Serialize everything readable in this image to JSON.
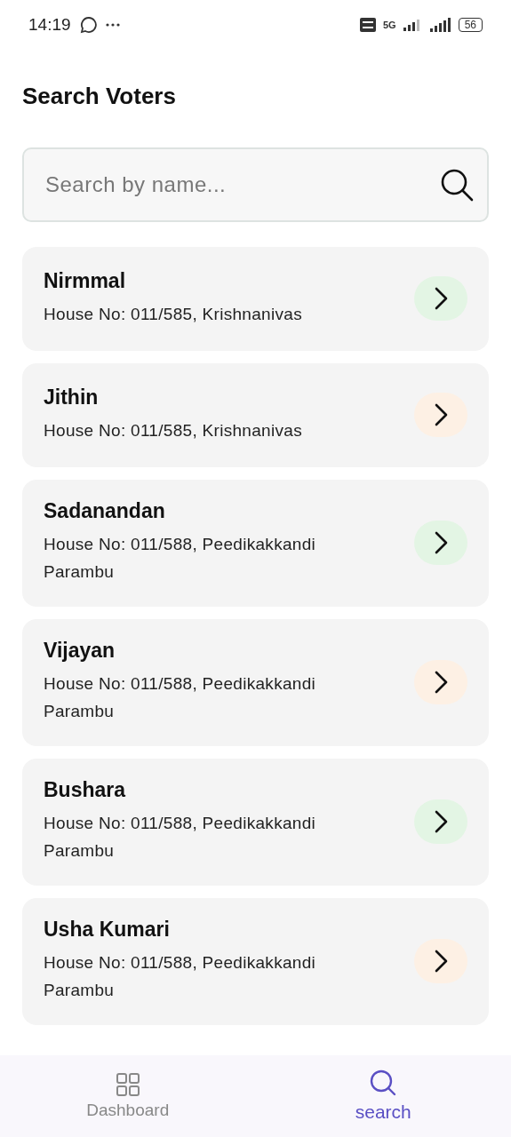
{
  "status_bar": {
    "time": "14:19",
    "network": "5G",
    "battery": "56"
  },
  "title": "Search Voters",
  "search": {
    "placeholder": "Search by name..."
  },
  "voters": [
    {
      "name": "Nirmmal",
      "address": "House No: 011/585, Krishnanivas",
      "color": "#e3f5e4"
    },
    {
      "name": "Jithin",
      "address": "House No: 011/585, Krishnanivas",
      "color": "#fdf0e4"
    },
    {
      "name": "Sadanandan",
      "address": "House No: 011/588, Peedikakkandi Parambu",
      "color": "#e3f5e4"
    },
    {
      "name": "Vijayan",
      "address": "House No: 011/588, Peedikakkandi Parambu",
      "color": "#fdf0e4"
    },
    {
      "name": "Bushara",
      "address": "House No: 011/588, Peedikakkandi Parambu",
      "color": "#e3f5e4"
    },
    {
      "name": "Usha Kumari",
      "address": "House No: 011/588, Peedikakkandi Parambu",
      "color": "#fdf0e4"
    }
  ],
  "nav": [
    {
      "kind": "grid",
      "label": "Dashboard",
      "selected": false
    },
    {
      "kind": "search",
      "label": "search",
      "selected": true
    }
  ]
}
